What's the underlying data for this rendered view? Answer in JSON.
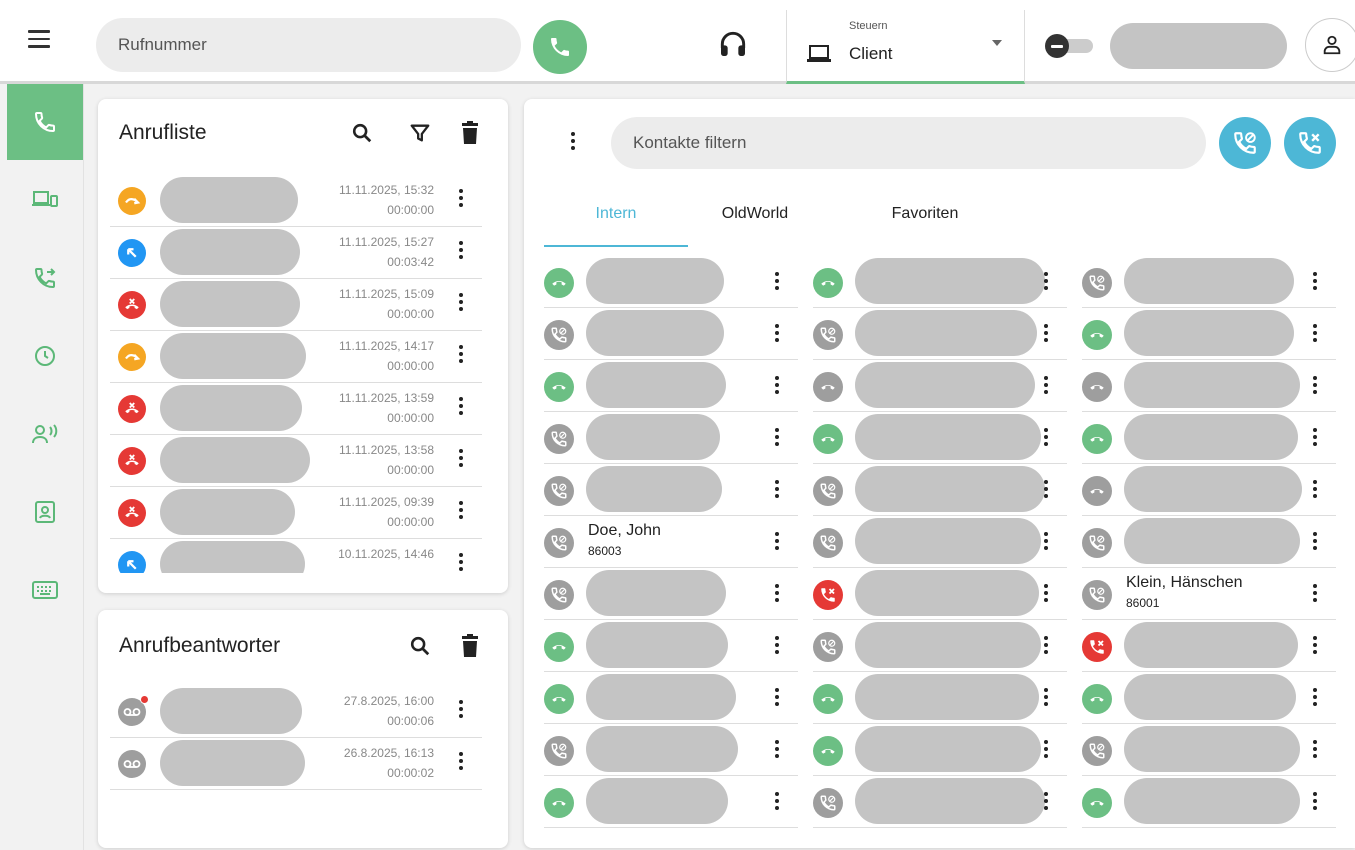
{
  "topbar": {
    "dial_placeholder": "Rufnummer",
    "control_label": "Steuern",
    "control_value": "Client"
  },
  "sidebar": {
    "items": [
      {
        "icon": "phone-icon",
        "active": true
      },
      {
        "icon": "devices-icon",
        "active": false
      },
      {
        "icon": "call-forward-icon",
        "active": false
      },
      {
        "icon": "clock-icon",
        "active": false
      },
      {
        "icon": "contact-speaker-icon",
        "active": false
      },
      {
        "icon": "address-book-icon",
        "active": false
      },
      {
        "icon": "keyboard-icon",
        "active": false
      }
    ]
  },
  "calllist": {
    "title": "Anrufliste",
    "rows": [
      {
        "type": "redirected",
        "color": "#f5a623",
        "date": "11.11.2025, 15:32",
        "duration": "00:00:00"
      },
      {
        "type": "incoming",
        "color": "#2196f3",
        "date": "11.11.2025, 15:27",
        "duration": "00:03:42"
      },
      {
        "type": "missed",
        "color": "#e53935",
        "date": "11.11.2025, 15:09",
        "duration": "00:00:00"
      },
      {
        "type": "redirected",
        "color": "#f5a623",
        "date": "11.11.2025, 14:17",
        "duration": "00:00:00"
      },
      {
        "type": "missed",
        "color": "#e53935",
        "date": "11.11.2025, 13:59",
        "duration": "00:00:00"
      },
      {
        "type": "missed",
        "color": "#e53935",
        "date": "11.11.2025, 13:58",
        "duration": "00:00:00"
      },
      {
        "type": "missed",
        "color": "#e53935",
        "date": "11.11.2025, 09:39",
        "duration": "00:00:00"
      },
      {
        "type": "incoming",
        "color": "#2196f3",
        "date": "10.11.2025, 14:46",
        "duration": ""
      }
    ]
  },
  "voicemail": {
    "title": "Anrufbeantworter",
    "rows": [
      {
        "date": "27.8.2025, 16:00",
        "duration": "00:00:06",
        "unread": true
      },
      {
        "date": "26.8.2025, 16:13",
        "duration": "00:00:02",
        "unread": false
      }
    ]
  },
  "contacts": {
    "filter_placeholder": "Kontakte filtern",
    "tabs": [
      "Intern",
      "OldWorld",
      "Favoriten"
    ],
    "active_tab": "Intern",
    "columns": [
      [
        {
          "status": "available",
          "name": "",
          "number": ""
        },
        {
          "status": "offline",
          "name": "",
          "number": ""
        },
        {
          "status": "available",
          "name": "",
          "number": ""
        },
        {
          "status": "offline",
          "name": "",
          "number": ""
        },
        {
          "status": "offline",
          "name": "",
          "number": ""
        },
        {
          "status": "offline",
          "name": "Doe, John",
          "number": "86003"
        },
        {
          "status": "offline",
          "name": "",
          "number": ""
        },
        {
          "status": "available",
          "name": "",
          "number": ""
        },
        {
          "status": "available",
          "name": "",
          "number": ""
        },
        {
          "status": "offline",
          "name": "",
          "number": ""
        },
        {
          "status": "available",
          "name": "",
          "number": ""
        }
      ],
      [
        {
          "status": "available",
          "name": "",
          "number": ""
        },
        {
          "status": "offline",
          "name": "",
          "number": ""
        },
        {
          "status": "idle",
          "name": "",
          "number": ""
        },
        {
          "status": "available",
          "name": "",
          "number": ""
        },
        {
          "status": "offline",
          "name": "",
          "number": ""
        },
        {
          "status": "offline",
          "name": "",
          "number": ""
        },
        {
          "status": "busy",
          "name": "",
          "number": ""
        },
        {
          "status": "offline",
          "name": "",
          "number": ""
        },
        {
          "status": "available",
          "name": "",
          "number": ""
        },
        {
          "status": "available",
          "name": "",
          "number": ""
        },
        {
          "status": "offline",
          "name": "",
          "number": ""
        }
      ],
      [
        {
          "status": "offline",
          "name": "",
          "number": ""
        },
        {
          "status": "available",
          "name": "",
          "number": ""
        },
        {
          "status": "idle",
          "name": "",
          "number": ""
        },
        {
          "status": "available",
          "name": "",
          "number": ""
        },
        {
          "status": "idle",
          "name": "",
          "number": ""
        },
        {
          "status": "offline",
          "name": "",
          "number": ""
        },
        {
          "status": "offline",
          "name": "Klein, Hänschen",
          "number": "86001"
        },
        {
          "status": "busy",
          "name": "",
          "number": ""
        },
        {
          "status": "available",
          "name": "",
          "number": ""
        },
        {
          "status": "offline",
          "name": "",
          "number": ""
        },
        {
          "status": "available",
          "name": "",
          "number": ""
        }
      ]
    ]
  },
  "colors": {
    "accent_green": "#6cbf84",
    "accent_blue": "#4db7d6",
    "offline_gray": "#9e9e9e",
    "busy_red": "#e53935"
  }
}
